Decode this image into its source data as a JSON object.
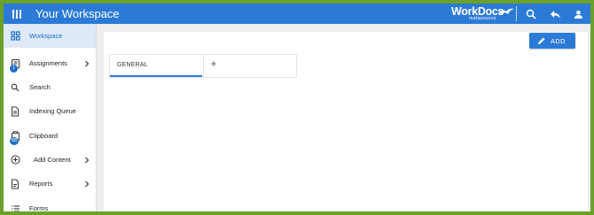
{
  "header": {
    "title": "Your Workspace",
    "brand_name": "WorkDocs",
    "brand_sub": "metasource",
    "icons": [
      "menu-icon",
      "search-icon",
      "reply-icon",
      "user-icon"
    ]
  },
  "sidebar": {
    "items": [
      {
        "label": "Workspace",
        "icon": "grid-icon",
        "active": true
      },
      {
        "label": "Assignments",
        "icon": "assignments-icon",
        "badge": "1",
        "has_chevron": true
      },
      {
        "label": "Search",
        "icon": "search-icon"
      },
      {
        "label": "Indexing Queue",
        "icon": "document-icon"
      },
      {
        "label": "Clipboard",
        "icon": "clipboard-icon",
        "badge": "68"
      },
      {
        "label": "Add Content",
        "icon": "plus-circle-icon",
        "has_chevron": true
      },
      {
        "label": "Reports",
        "icon": "report-icon",
        "has_chevron": true
      },
      {
        "label": "Forms",
        "icon": "list-icon"
      }
    ]
  },
  "main": {
    "add_button_label": "ADD",
    "tabs": [
      {
        "label": "GENERAL",
        "active": true
      }
    ],
    "add_tab_symbol": "+"
  },
  "colors": {
    "accent": "#2b7bd6",
    "active_bg": "#dde9f6",
    "frame_border": "#6aa12a"
  }
}
